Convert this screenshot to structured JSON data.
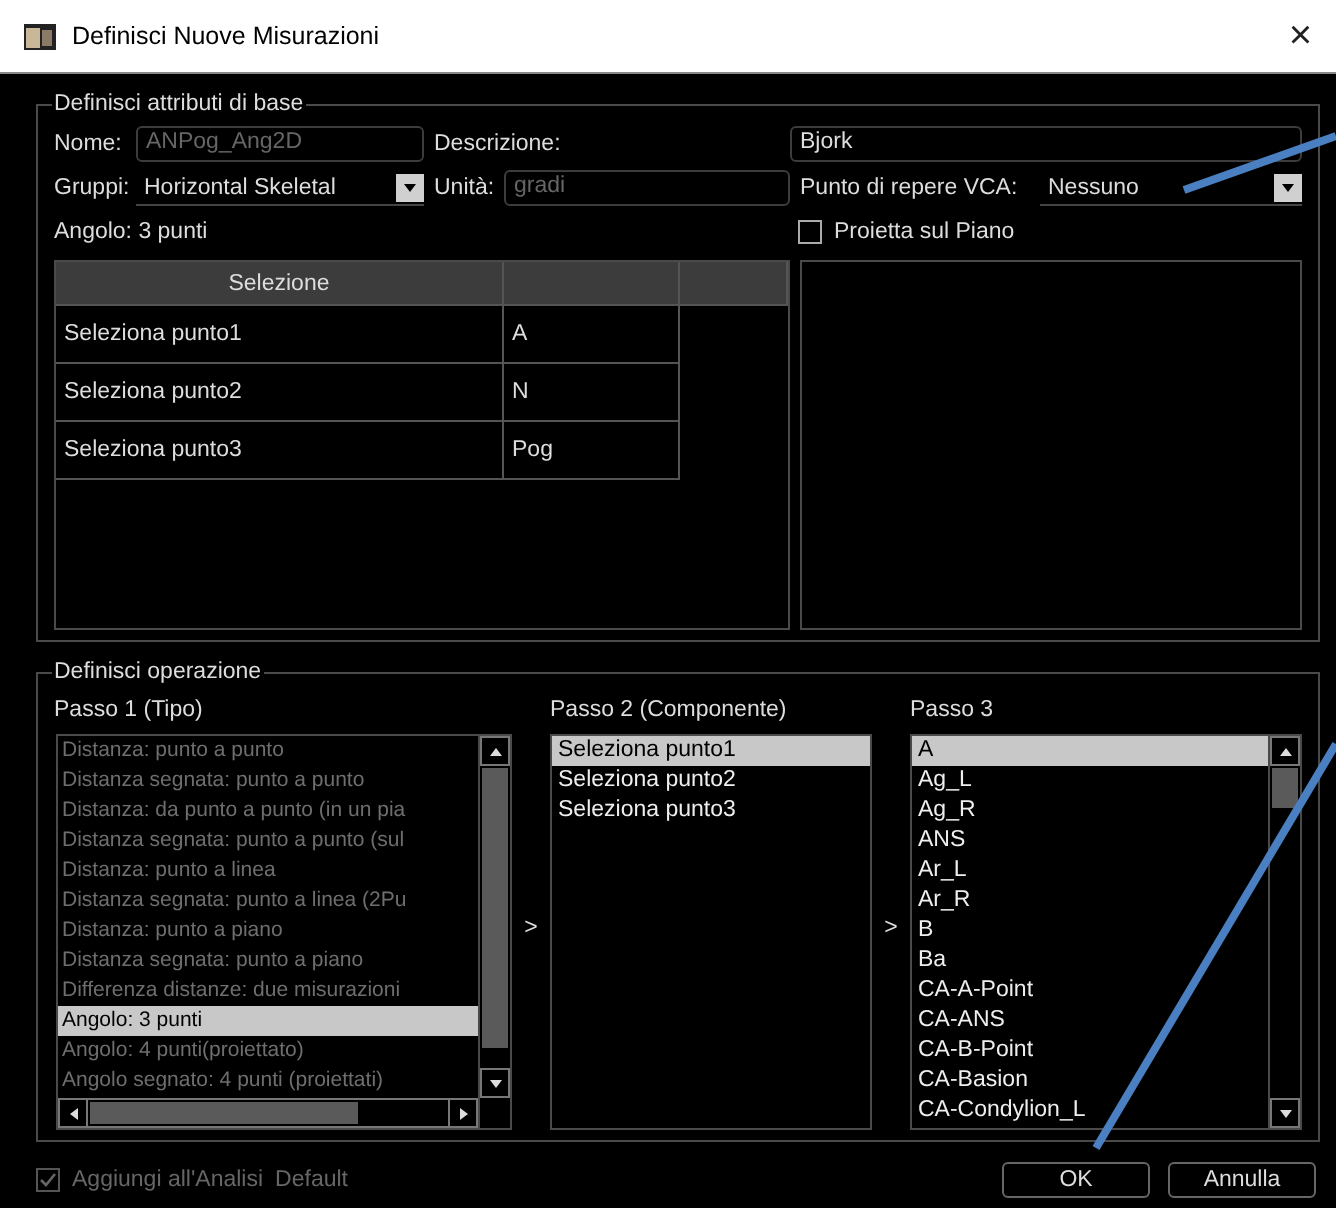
{
  "window": {
    "title": "Definisci Nuove Misurazioni",
    "close": "×"
  },
  "basic": {
    "legend": "Definisci attributi di base",
    "name": {
      "label": "Nome:",
      "value": "ANPog_Ang2D",
      "disabled": true
    },
    "description": {
      "label": "Descrizione:",
      "value": "Bjork",
      "disabled": false
    },
    "groups": {
      "label": "Gruppi:",
      "value": "Horizontal Skeletal"
    },
    "unit": {
      "label": "Unità:",
      "value": "gradi",
      "disabled": true
    },
    "vca_point": {
      "label": "Punto di repere VCA:",
      "value": "Nessuno"
    },
    "type_label": "Angolo: 3 punti",
    "project": {
      "label": "Proietta sul Piano",
      "checked": false
    },
    "table": {
      "columns": [
        "Selezione"
      ],
      "rows": [
        [
          "Seleziona punto1",
          "A"
        ],
        [
          "Seleziona punto2",
          "N"
        ],
        [
          "Seleziona punto3",
          "Pog"
        ]
      ]
    }
  },
  "operation": {
    "legend": "Definisci operazione",
    "steps": [
      {
        "label": "Passo 1 (Tipo)",
        "items": [
          {
            "text": "Distanza: punto a punto",
            "selected": false,
            "disabled": true
          },
          {
            "text": "Distanza segnata: punto a punto",
            "selected": false,
            "disabled": true
          },
          {
            "text": "Distanza: da punto a punto (in un pia",
            "selected": false,
            "disabled": true
          },
          {
            "text": "Distanza segnata: punto a punto (sul",
            "selected": false,
            "disabled": true
          },
          {
            "text": "Distanza: punto a linea",
            "selected": false,
            "disabled": true
          },
          {
            "text": "Distanza segnata: punto a linea (2Pu",
            "selected": false,
            "disabled": true
          },
          {
            "text": "Distanza: punto a piano",
            "selected": false,
            "disabled": true
          },
          {
            "text": "Distanza segnata: punto a piano",
            "selected": false,
            "disabled": true
          },
          {
            "text": "Differenza distanze: due misurazioni",
            "selected": false,
            "disabled": true
          },
          {
            "text": "Angolo: 3 punti",
            "selected": true,
            "disabled": false
          },
          {
            "text": "Angolo: 4 punti(proiettato)",
            "selected": false,
            "disabled": true
          },
          {
            "text": "Angolo segnato: 4 punti (proiettati)",
            "selected": false,
            "disabled": true
          }
        ]
      },
      {
        "label": "Passo 2 (Componente)",
        "arrow": ">",
        "items": [
          {
            "text": "Seleziona punto1",
            "selected": true,
            "disabled": false
          },
          {
            "text": "Seleziona punto2",
            "selected": false,
            "disabled": false
          },
          {
            "text": "Seleziona punto3",
            "selected": false,
            "disabled": false
          }
        ]
      },
      {
        "label": "Passo 3",
        "arrow": ">",
        "items": [
          {
            "text": "A",
            "selected": true,
            "disabled": false
          },
          {
            "text": "Ag_L",
            "selected": false,
            "disabled": false
          },
          {
            "text": "Ag_R",
            "selected": false,
            "disabled": false
          },
          {
            "text": "ANS",
            "selected": false,
            "disabled": false
          },
          {
            "text": "Ar_L",
            "selected": false,
            "disabled": false
          },
          {
            "text": "Ar_R",
            "selected": false,
            "disabled": false
          },
          {
            "text": "B",
            "selected": false,
            "disabled": false
          },
          {
            "text": "Ba",
            "selected": false,
            "disabled": false
          },
          {
            "text": "CA-A-Point",
            "selected": false,
            "disabled": false
          },
          {
            "text": "CA-ANS",
            "selected": false,
            "disabled": false
          },
          {
            "text": "CA-B-Point",
            "selected": false,
            "disabled": false
          },
          {
            "text": "CA-Basion",
            "selected": false,
            "disabled": false
          },
          {
            "text": "CA-Condylion_L",
            "selected": false,
            "disabled": false
          }
        ]
      }
    ]
  },
  "footer": {
    "add": {
      "label": "Aggiungi all'Analisi",
      "checked": true,
      "disabled": true
    },
    "default": "Default",
    "buttons": [
      {
        "label": "OK"
      },
      {
        "label": "Annulla"
      }
    ]
  },
  "annotations": [
    {
      "kind": "line"
    },
    {
      "kind": "line"
    }
  ]
}
